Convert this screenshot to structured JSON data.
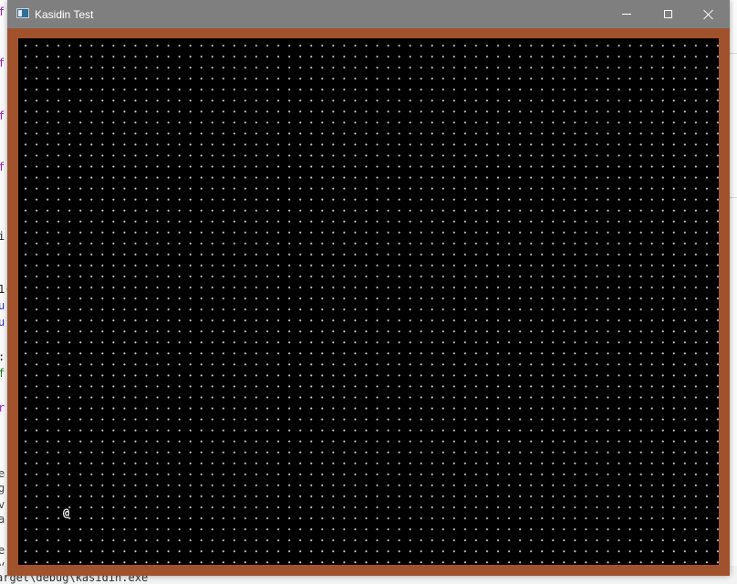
{
  "window": {
    "title": "Kasidin Test",
    "app_icon": "console-window-icon",
    "controls": {
      "minimize_icon": "minimize-icon",
      "maximize_icon": "maximize-icon",
      "close_icon": "close-icon"
    }
  },
  "game": {
    "border_color": "#a0522d",
    "floor_color": "#000000",
    "floor_dot_color": "#c9c9c9",
    "player_glyph": "@",
    "player_color": "#ffffff"
  },
  "background_editor": {
    "left_glyphs": [
      "f",
      "(",
      "f",
      "(",
      "f",
      "(",
      "f",
      "(",
      "i",
      "1(",
      "u",
      "u",
      ":",
      "f",
      "r",
      "e",
      "g",
      "v",
      "a",
      "e",
      "v"
    ],
    "terminal_line": "arget\\debug\\kasidin.exe`"
  }
}
